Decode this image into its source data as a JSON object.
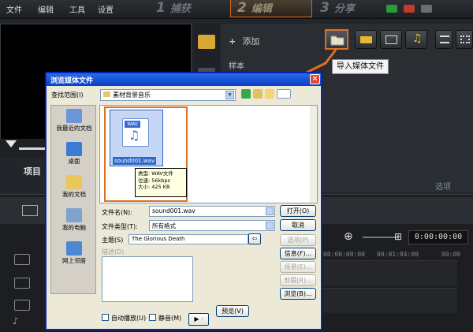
{
  "menubar": {
    "items": [
      "文件",
      "编辑",
      "工具",
      "设置"
    ],
    "steps": [
      {
        "num": "1",
        "label": "捕获"
      },
      {
        "num": "2",
        "label": "编辑"
      },
      {
        "num": "3",
        "label": "分享"
      }
    ]
  },
  "preview": {
    "project_label": "项目"
  },
  "library": {
    "add_label": "添加",
    "sample_label": "样本",
    "tooltip": "导入媒体文件",
    "options_label": "选项"
  },
  "timeline": {
    "timecode": "0:00:00:00",
    "ruler": [
      "00:00:00:00",
      "00:01:04:00",
      "00:00"
    ]
  },
  "dialog": {
    "title": "浏览媒体文件",
    "close_glyph": "×",
    "lookin_label": "查找范围(I)",
    "lookin_value": "素材背景音乐",
    "places": [
      "我最近的文档",
      "桌面",
      "我的文档",
      "我的电脑",
      "网上邻居"
    ],
    "file": {
      "tag": "WAV",
      "name": "sound001.wav",
      "info": [
        "类型: WAV文件",
        "位速: 56kbps",
        "大小: 425 KB"
      ]
    },
    "filename_label": "文件名(N):",
    "filename_value": "sound001.wav",
    "filetype_label": "文件类型(T):",
    "filetype_value": "所有格式",
    "subject_label": "主题(S)",
    "subject_value": "The Glorious Death",
    "desc_label": "描述(D)",
    "buttons": {
      "open": "打开(O)",
      "cancel": "取消",
      "options": "选项(P)",
      "info": "信息(F)...",
      "scene": "场景(E)...",
      "trim": "剪辑(R)...",
      "browse": "浏览(B)...",
      "preview": "预览(V)"
    },
    "autoplay_label": "自动播放(U)",
    "mute_label": "静音(M)",
    "play_glyph": "▶ ·"
  },
  "colors": {
    "accent": "#e07020",
    "xp_title": "#0a3fc7"
  }
}
